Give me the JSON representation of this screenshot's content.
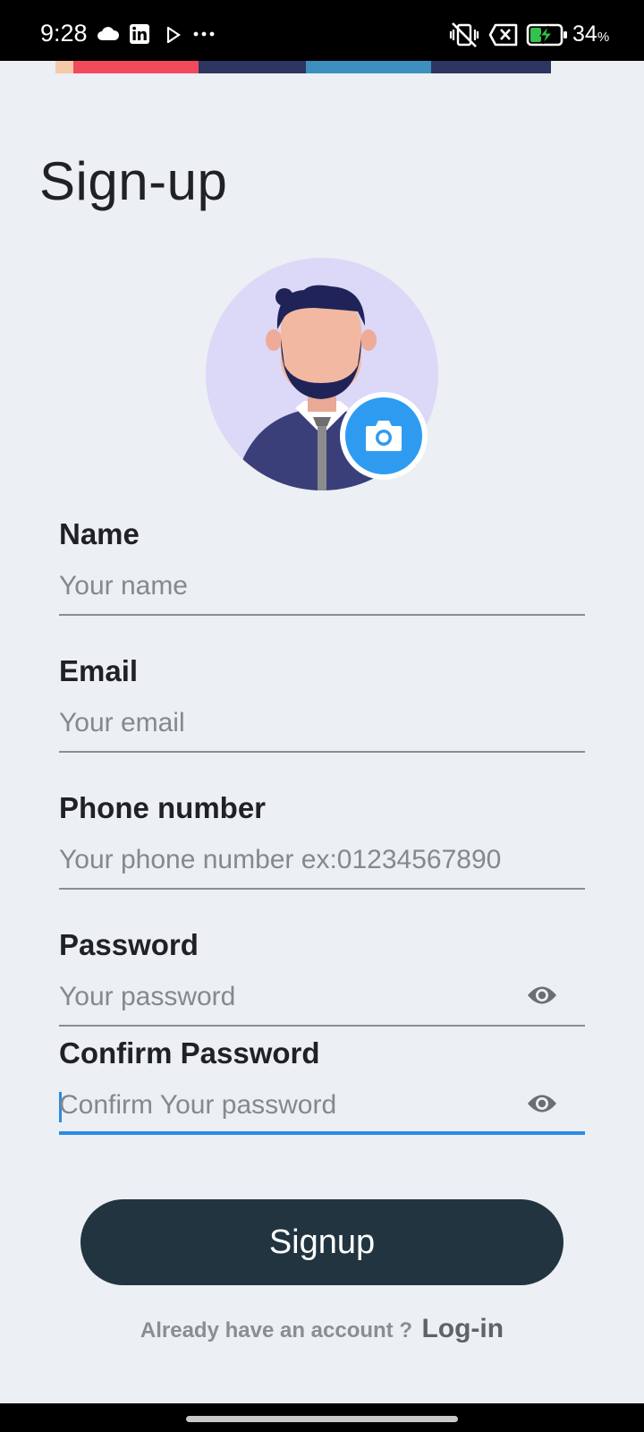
{
  "status_bar": {
    "time": "9:28",
    "battery_percent": "34",
    "battery_unit": "%",
    "icons": [
      "cloud-icon",
      "linkedin-icon",
      "play-store-icon",
      "more-icon",
      "vibrate-off-icon",
      "sim-off-icon",
      "battery-charging-icon"
    ]
  },
  "page": {
    "title": "Sign-up"
  },
  "avatar": {
    "icon": "user-avatar-icon",
    "action_icon": "camera-icon",
    "accent": "#2f9bf0"
  },
  "form": {
    "name": {
      "label": "Name",
      "placeholder": "Your name"
    },
    "email": {
      "label": "Email",
      "placeholder": "Your email"
    },
    "phone": {
      "label": "Phone number",
      "placeholder": "Your phone number ex:01234567890"
    },
    "password": {
      "label": "Password",
      "placeholder": "Your password",
      "icon": "eye-icon"
    },
    "confirm_password": {
      "label": "Confirm Password",
      "placeholder": "Confirm Your password",
      "icon": "eye-icon",
      "focused": true
    }
  },
  "signup_button": {
    "label": "Signup",
    "color": "#223440"
  },
  "login_prompt": {
    "question": "Already have an account ?",
    "link": "Log-in"
  }
}
